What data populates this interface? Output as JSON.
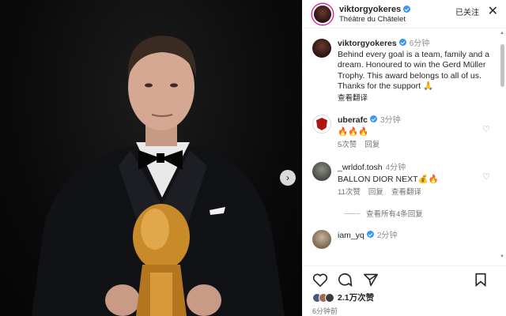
{
  "post": {
    "username": "viktorgyokeres",
    "location": "Théâtre du Châtelet",
    "follow_status": "已关注",
    "caption_time": "6分钟",
    "caption": "Behind every goal is a team, family and a dream. Honoured to win the Gerd Müller Trophy. This award belongs to all of us. Thanks for the support 🙏",
    "translate_label": "查看翻译",
    "likes": "2.1万次赞",
    "posted_ago": "6分钟前"
  },
  "comments": [
    {
      "username": "uberafc",
      "time": "3分钟",
      "text": "🔥🔥🔥",
      "likes": "5次赞",
      "reply": "回复",
      "translate": ""
    },
    {
      "username": "_wrldof.tosh",
      "time": "4分钟",
      "text": "BALLON DIOR NEXT💰🔥",
      "likes": "11次赞",
      "reply": "回复",
      "translate": "查看翻译"
    },
    {
      "username": "iam_yq",
      "time": "2分钟",
      "text": "",
      "likes": "",
      "reply": "",
      "translate": ""
    }
  ],
  "view_replies_label": "查看所有4条回复",
  "icons": {
    "close": "close-icon",
    "next": "chevron-right-icon",
    "like": "heart-icon",
    "comment": "comment-icon",
    "share": "share-icon",
    "save": "bookmark-icon",
    "verified": "verified-badge-icon"
  },
  "colors": {
    "verified": "#3897f0",
    "trophy": "#c98a2a"
  }
}
